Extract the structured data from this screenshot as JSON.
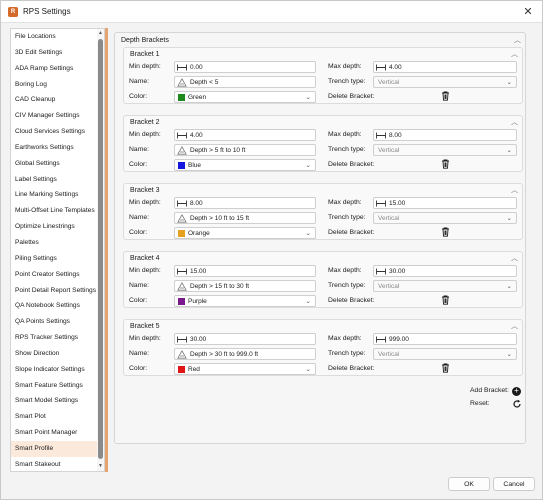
{
  "window": {
    "title": "RPS Settings",
    "app_icon": "rps-app-icon",
    "close_glyph": "✕"
  },
  "sidebar": {
    "items": [
      {
        "label": "File Locations"
      },
      {
        "label": "3D Edit Settings"
      },
      {
        "label": "ADA Ramp Settings"
      },
      {
        "label": "Boring Log"
      },
      {
        "label": "CAD Cleanup"
      },
      {
        "label": "CIV Manager Settings"
      },
      {
        "label": "Cloud Services Settings"
      },
      {
        "label": "Earthworks Settings"
      },
      {
        "label": "Global Settings"
      },
      {
        "label": "Label Settings"
      },
      {
        "label": "Line Marking Settings"
      },
      {
        "label": "Multi-Offset Line Templates"
      },
      {
        "label": "Optimize Linestrings"
      },
      {
        "label": "Palettes"
      },
      {
        "label": "Piling Settings"
      },
      {
        "label": "Point Creator Settings"
      },
      {
        "label": "Point Detail Report Settings"
      },
      {
        "label": "QA Notebook Settings"
      },
      {
        "label": "QA Points Settings"
      },
      {
        "label": "RPS Tracker Settings"
      },
      {
        "label": "Show Direction"
      },
      {
        "label": "Slope Indicator Settings"
      },
      {
        "label": "Smart Feature Settings"
      },
      {
        "label": "Smart Model Settings"
      },
      {
        "label": "Smart Plot"
      },
      {
        "label": "Smart Point Manager"
      },
      {
        "label": "Smart Profile"
      },
      {
        "label": "Smart Stakeout"
      }
    ],
    "active_index": 26
  },
  "group": {
    "title": "Depth Brackets"
  },
  "labels": {
    "min_depth": "Min depth:",
    "max_depth": "Max depth:",
    "name": "Name:",
    "trench_type": "Trench type:",
    "color": "Color:",
    "delete_bracket": "Delete Bracket:"
  },
  "brackets": [
    {
      "title": "Bracket 1",
      "min_depth": "0.00",
      "max_depth": "4.00",
      "name": "Depth < 5",
      "trench_type": "Vertical",
      "color_name": "Green",
      "color_hex": "#1e8a1e"
    },
    {
      "title": "Bracket 2",
      "min_depth": "4.00",
      "max_depth": "8.00",
      "name": "Depth > 5 ft to 10 ft",
      "trench_type": "Vertical",
      "color_name": "Blue",
      "color_hex": "#1515e0"
    },
    {
      "title": "Bracket 3",
      "min_depth": "8.00",
      "max_depth": "15.00",
      "name": "Depth > 10 ft to 15 ft",
      "trench_type": "Vertical",
      "color_name": "Orange",
      "color_hex": "#e6a020"
    },
    {
      "title": "Bracket 4",
      "min_depth": "15.00",
      "max_depth": "30.00",
      "name": "Depth > 15 ft to 30 ft",
      "trench_type": "Vertical",
      "color_name": "Purple",
      "color_hex": "#7a1a8a"
    },
    {
      "title": "Bracket 5",
      "min_depth": "30.00",
      "max_depth": "999.00",
      "name": "Depth > 30 ft to 999.0 ft",
      "trench_type": "Vertical",
      "color_name": "Red",
      "color_hex": "#e01515"
    }
  ],
  "actions": {
    "add_bracket": "Add Bracket:",
    "reset": "Reset:"
  },
  "footer": {
    "ok": "OK",
    "cancel": "Cancel"
  },
  "colors": {
    "accent": "#e8a46f",
    "active_item_bg": "#fbe9dc"
  }
}
